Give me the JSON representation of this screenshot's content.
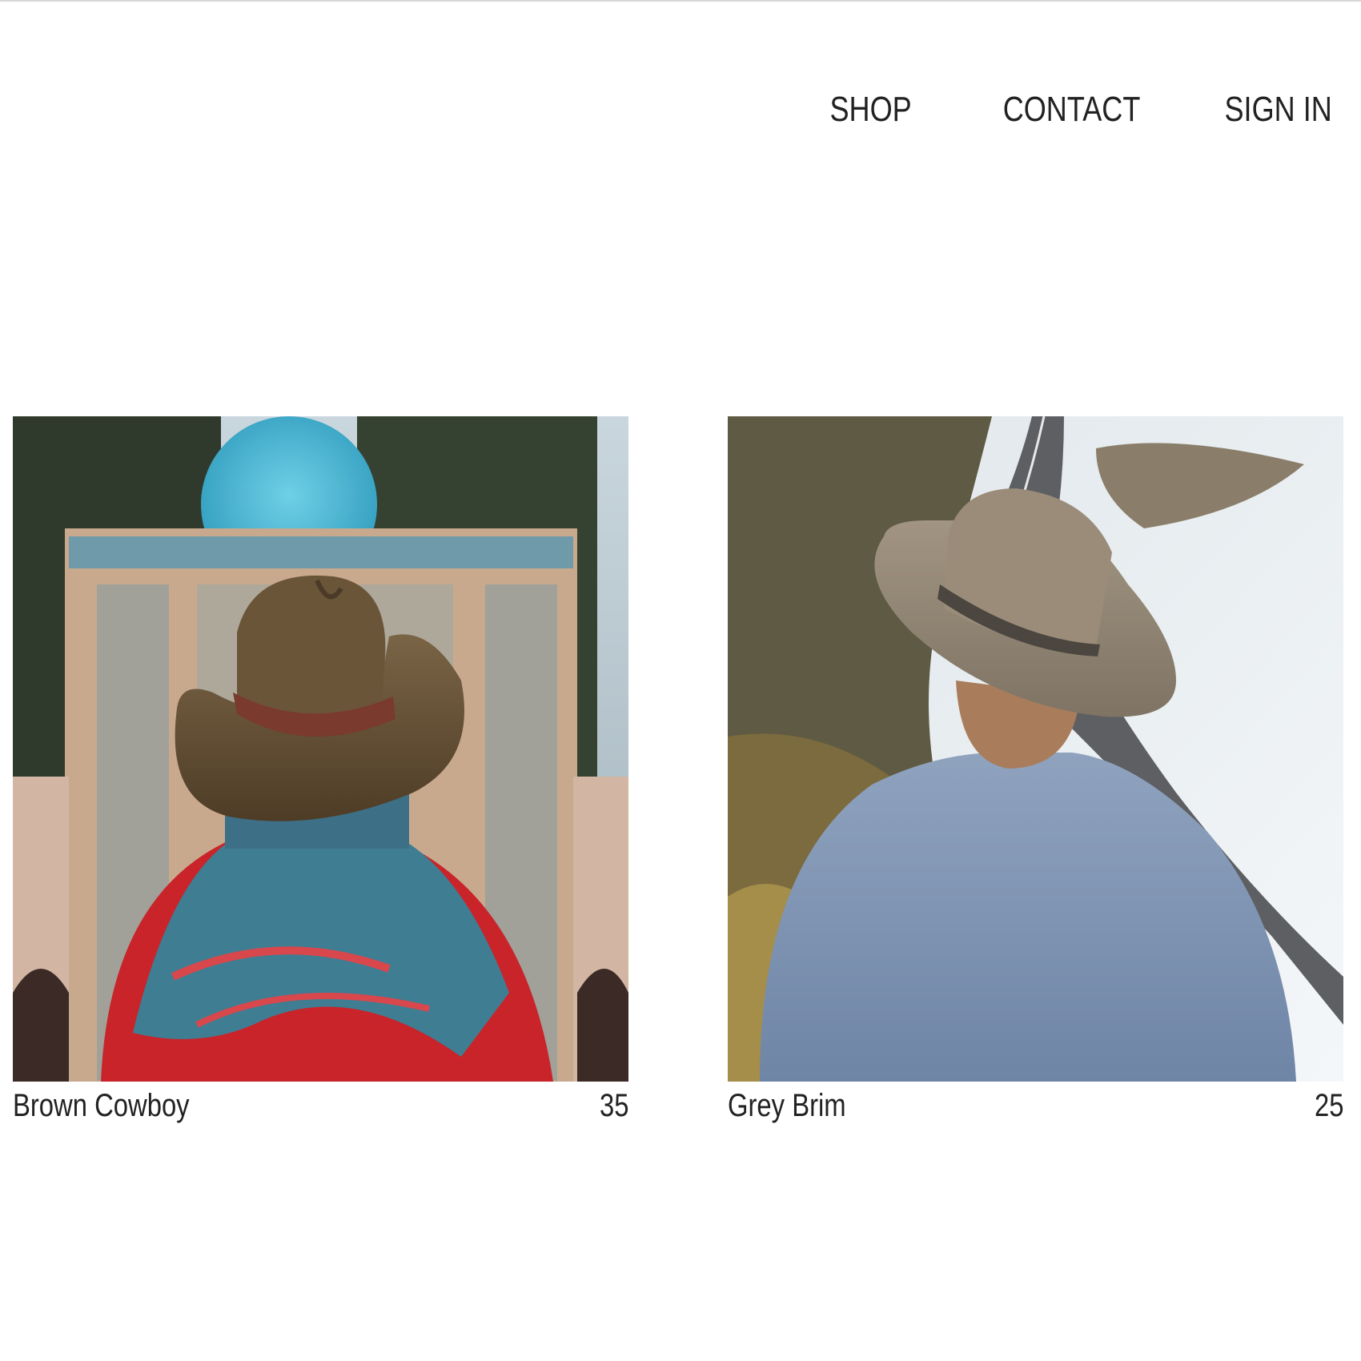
{
  "nav": {
    "items": [
      {
        "label": "SHOP"
      },
      {
        "label": "CONTACT"
      },
      {
        "label": "SIGN IN"
      }
    ]
  },
  "products": [
    {
      "name": "Brown Cowboy",
      "price": "35",
      "image_icon": "photo-brown-cowboy-hat"
    },
    {
      "name": "Grey Brim",
      "price": "25",
      "image_icon": "photo-grey-brim-hat"
    }
  ],
  "colors": {
    "text": "#222222",
    "background": "#ffffff"
  }
}
